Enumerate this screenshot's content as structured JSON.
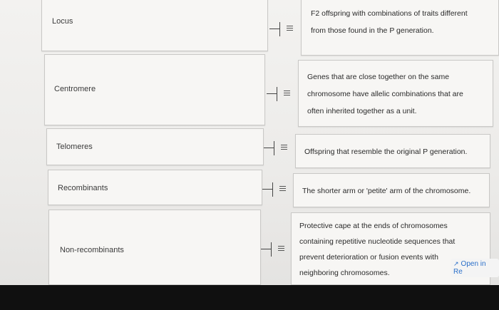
{
  "terms": [
    {
      "label": "Locus"
    },
    {
      "label": "Centromere"
    },
    {
      "label": "Telomeres"
    },
    {
      "label": "Recombinants"
    },
    {
      "label": "Non-recombinants"
    }
  ],
  "definitions": [
    {
      "lines": [
        "F2 offspring with combinations of traits different",
        "from those found in the P generation."
      ]
    },
    {
      "lines": [
        "Genes that are close together on the same",
        "chromosome have allelic combinations that are",
        "often inherited together as a unit."
      ]
    },
    {
      "lines": [
        "Offspring that resemble the original P generation."
      ]
    },
    {
      "lines": [
        "The shorter arm or 'petite' arm of the chromosome."
      ]
    },
    {
      "lines": [
        "Protective cape at the ends of chromosomes",
        "containing repetitive nucleotide sequences that",
        "prevent deterioration or fusion events with",
        "neighboring chromosomes."
      ]
    }
  ],
  "open_in": {
    "label": "Open in Re"
  }
}
